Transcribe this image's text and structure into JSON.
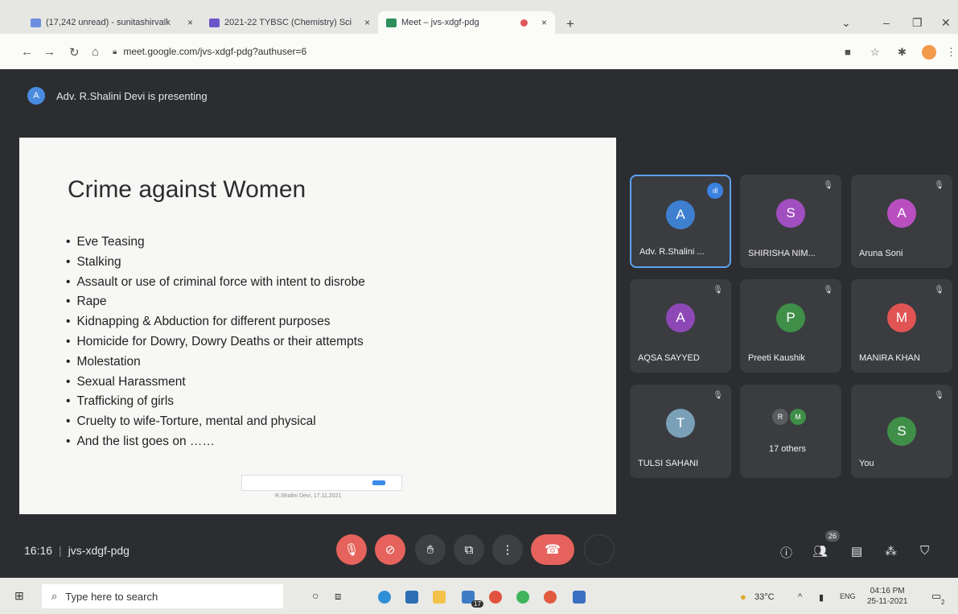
{
  "browser": {
    "tabs": [
      {
        "label": "(17,242 unread) - sunitashirvalk",
        "color": "#6d8ee0"
      },
      {
        "label": "2021-22 TYBSC (Chemistry) Sci",
        "color": "#6b54c9"
      },
      {
        "label": "Meet – jvs-xdgf-pdg",
        "color": "#2f8f5a"
      }
    ],
    "close_glyph": "×",
    "new_tab_glyph": "+",
    "url": "meet.google.com/jvs-xdgf-pdg?authuser=6"
  },
  "meet": {
    "presenter_initial": "A",
    "presenter_text": "Adv. R.Shalini Devi is presenting",
    "slide": {
      "title": "Crime against Women",
      "bullets": [
        "Eve Teasing",
        "Stalking",
        "Assault or use of criminal force with intent to disrobe",
        "Rape",
        "Kidnapping & Abduction for different purposes",
        "Homicide for Dowry, Dowry Deaths or their attempts",
        "Molestation",
        "Sexual Harassment",
        "Trafficking of girls",
        "Cruelty to wife-Torture, mental and physical",
        "And the list goes on ……"
      ],
      "footer": "R.Shalini Devi, 17.11.2021"
    },
    "participants": [
      {
        "initial": "A",
        "name": "Adv. R.Shalini ...",
        "color": "#3f7fd0",
        "speaking": true
      },
      {
        "initial": "S",
        "name": "SHIRISHA NIM...",
        "color": "#a04ec0",
        "speaking": false
      },
      {
        "initial": "A",
        "name": "Aruna Soni",
        "color": "#b94fbf",
        "speaking": false
      },
      {
        "initial": "A",
        "name": "AQSA SAYYED",
        "color": "#8e48b6",
        "speaking": false
      },
      {
        "initial": "P",
        "name": "Preeti Kaushik",
        "color": "#3f8f48",
        "speaking": false
      },
      {
        "initial": "M",
        "name": "MANIRA KHAN",
        "color": "#e15454",
        "speaking": false
      },
      {
        "initial": "T",
        "name": "TULSI SAHANI",
        "color": "#7aa0b8",
        "speaking": false
      },
      {
        "initial": "",
        "name": "17 others",
        "color": "#3f8f48",
        "speaking": false
      },
      {
        "initial": "S",
        "name": "You",
        "color": "#3f8f48",
        "speaking": false
      }
    ],
    "others_initials": [
      "R",
      "M"
    ],
    "time": "16:16",
    "meeting_code": "jvs-xdgf-pdg",
    "participant_count": "26"
  },
  "taskbar": {
    "search_placeholder": "Type here to search",
    "weather": "33°C",
    "language": "ENG",
    "time": "04:16 PM",
    "date": "25-11-2021",
    "mail_badge": "17",
    "notif_badge": "2"
  }
}
